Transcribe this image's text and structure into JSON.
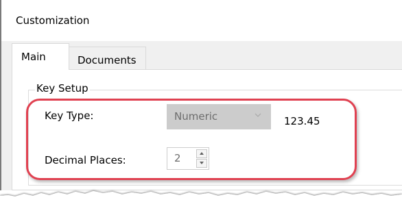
{
  "window": {
    "title": "Customization"
  },
  "tabs": [
    {
      "label": "Main",
      "active": true
    },
    {
      "label": "Documents",
      "active": false
    }
  ],
  "key_setup": {
    "group_title": "Key Setup",
    "key_type_label": "Key Type:",
    "key_type_value": "Numeric",
    "example_value": "123.45",
    "decimal_places_label": "Decimal Places:",
    "decimal_places_value": "2"
  },
  "icons": {
    "dropdown": "chevron-down-icon",
    "spin_up": "spin-up-arrow-icon",
    "spin_down": "spin-down-arrow-icon"
  },
  "colors": {
    "highlight": "#e04050",
    "disabled_text": "#6d6d6d",
    "disabled_field": "#cccccc"
  }
}
